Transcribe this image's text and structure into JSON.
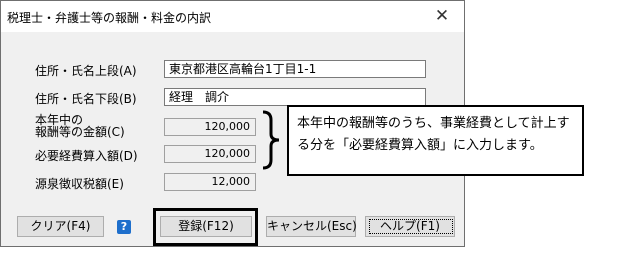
{
  "dialog": {
    "title": "税理士・弁護士等の報酬・料金の内訳",
    "close_glyph": "✕"
  },
  "fields": {
    "address_upper": {
      "label": "住所・氏名上段(A)",
      "value": "東京都港区高輪台1丁目1-1"
    },
    "address_lower": {
      "label": "住所・氏名下段(B)",
      "value": "経理　調介"
    },
    "income": {
      "label_line1": "本年中の",
      "label_line2": "報酬等の金額(C)",
      "value": "120,000"
    },
    "expense": {
      "label": "必要経費算入額(D)",
      "value": "120,000"
    },
    "tax": {
      "label": "源泉徴収税額(E)",
      "value": "12,000"
    }
  },
  "buttons": {
    "clear": "クリア(F4)",
    "register": "登録(F12)",
    "cancel": "キャンセル(Esc)",
    "help": "ヘルプ(F1)",
    "help_icon": "?"
  },
  "callout": {
    "text": "本年中の報酬等のうち、事業経費として計上する分を「必要経費算入額」に入力します。"
  },
  "icons": {
    "help": "question-icon",
    "close": "close-icon"
  },
  "colors": {
    "dialog_bg": "#f0f0f0",
    "help_icon": "#1e6fcc"
  }
}
